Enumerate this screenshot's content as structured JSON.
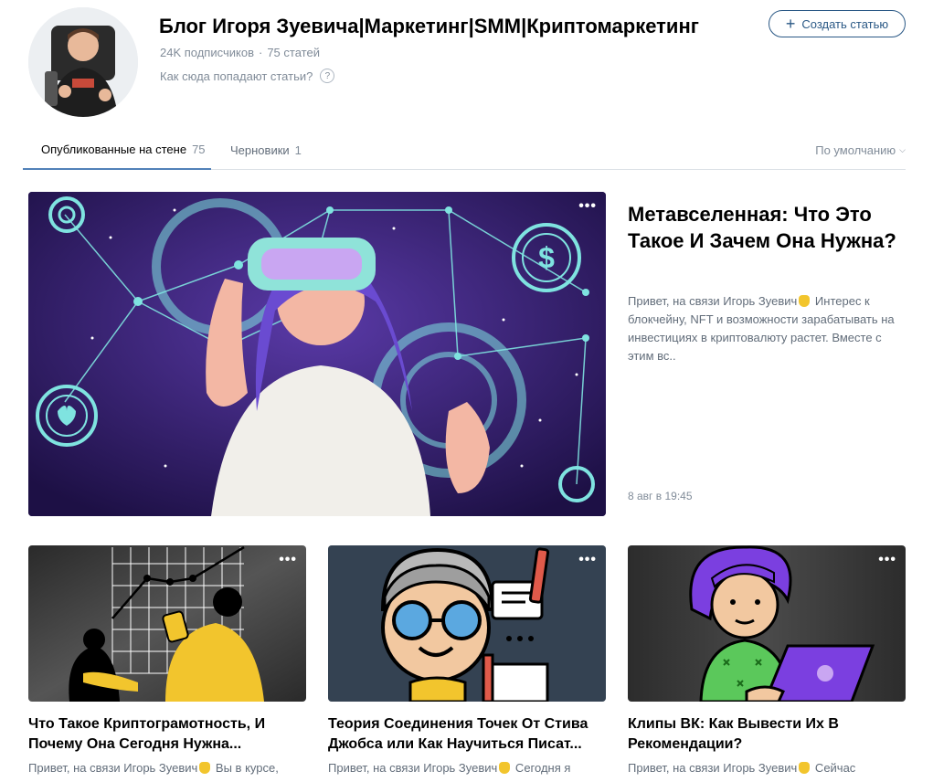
{
  "header": {
    "title": "Блог Игоря Зуевича|Маркетинг|SMM|Криптомаркетинг",
    "subscribers": "24K подписчиков",
    "separator": "·",
    "articles_count": "75 статей",
    "help_text": "Как сюда попадают статьи?",
    "help_icon_glyph": "?",
    "create_button": "Создать статью",
    "plus_glyph": "+"
  },
  "tabs": {
    "published": {
      "label": "Опубликованные на стене",
      "count": "75"
    },
    "drafts": {
      "label": "Черновики",
      "count": "1"
    },
    "sort_label": "По умолчанию",
    "sort_glyph": "⌵"
  },
  "more_glyph": "•••",
  "featured": {
    "title": "Метавселенная: Что Это Такое И Зачем Она Нужна?",
    "desc_a": "Привет, на связи Игорь Зуевич",
    "desc_b": " Интерес к блокчейну, NFT и возможности зарабатывать на инвестициях в криптовалюту растет. Вместе с этим вс..",
    "date": "8 авг в 19:45"
  },
  "cards": [
    {
      "title": "Что Такое Криптограмотность, И Почему Она Сегодня Нужна...",
      "desc_a": "Привет, на связи Игорь Зуевич",
      "desc_b": " Вы в курсе,"
    },
    {
      "title": "Теория Соединения Точек От Стива Джобса или Как Научиться Писат...",
      "desc_a": "Привет, на связи Игорь Зуевич",
      "desc_b": " Сегодня я"
    },
    {
      "title": "Клипы ВК: Как Вывести Их В Рекомендации?",
      "desc_a": "Привет, на связи Игорь Зуевич",
      "desc_b": " Сейчас"
    }
  ],
  "colors": {
    "link": "#2a5885",
    "tab_active": "#5181b8",
    "muted": "#818c99",
    "text_secondary": "#626d7a",
    "featured_bg": "#2b1a5e",
    "card1_bg": "#3c3c3c",
    "card2_bg": "#3a4a5c",
    "card3_bg": "#3a3a3a"
  },
  "icons": [
    "avatar-photo",
    "question-icon",
    "plus-icon",
    "chevron-down-icon",
    "more-dots-icon",
    "raised-hand-emoji"
  ]
}
